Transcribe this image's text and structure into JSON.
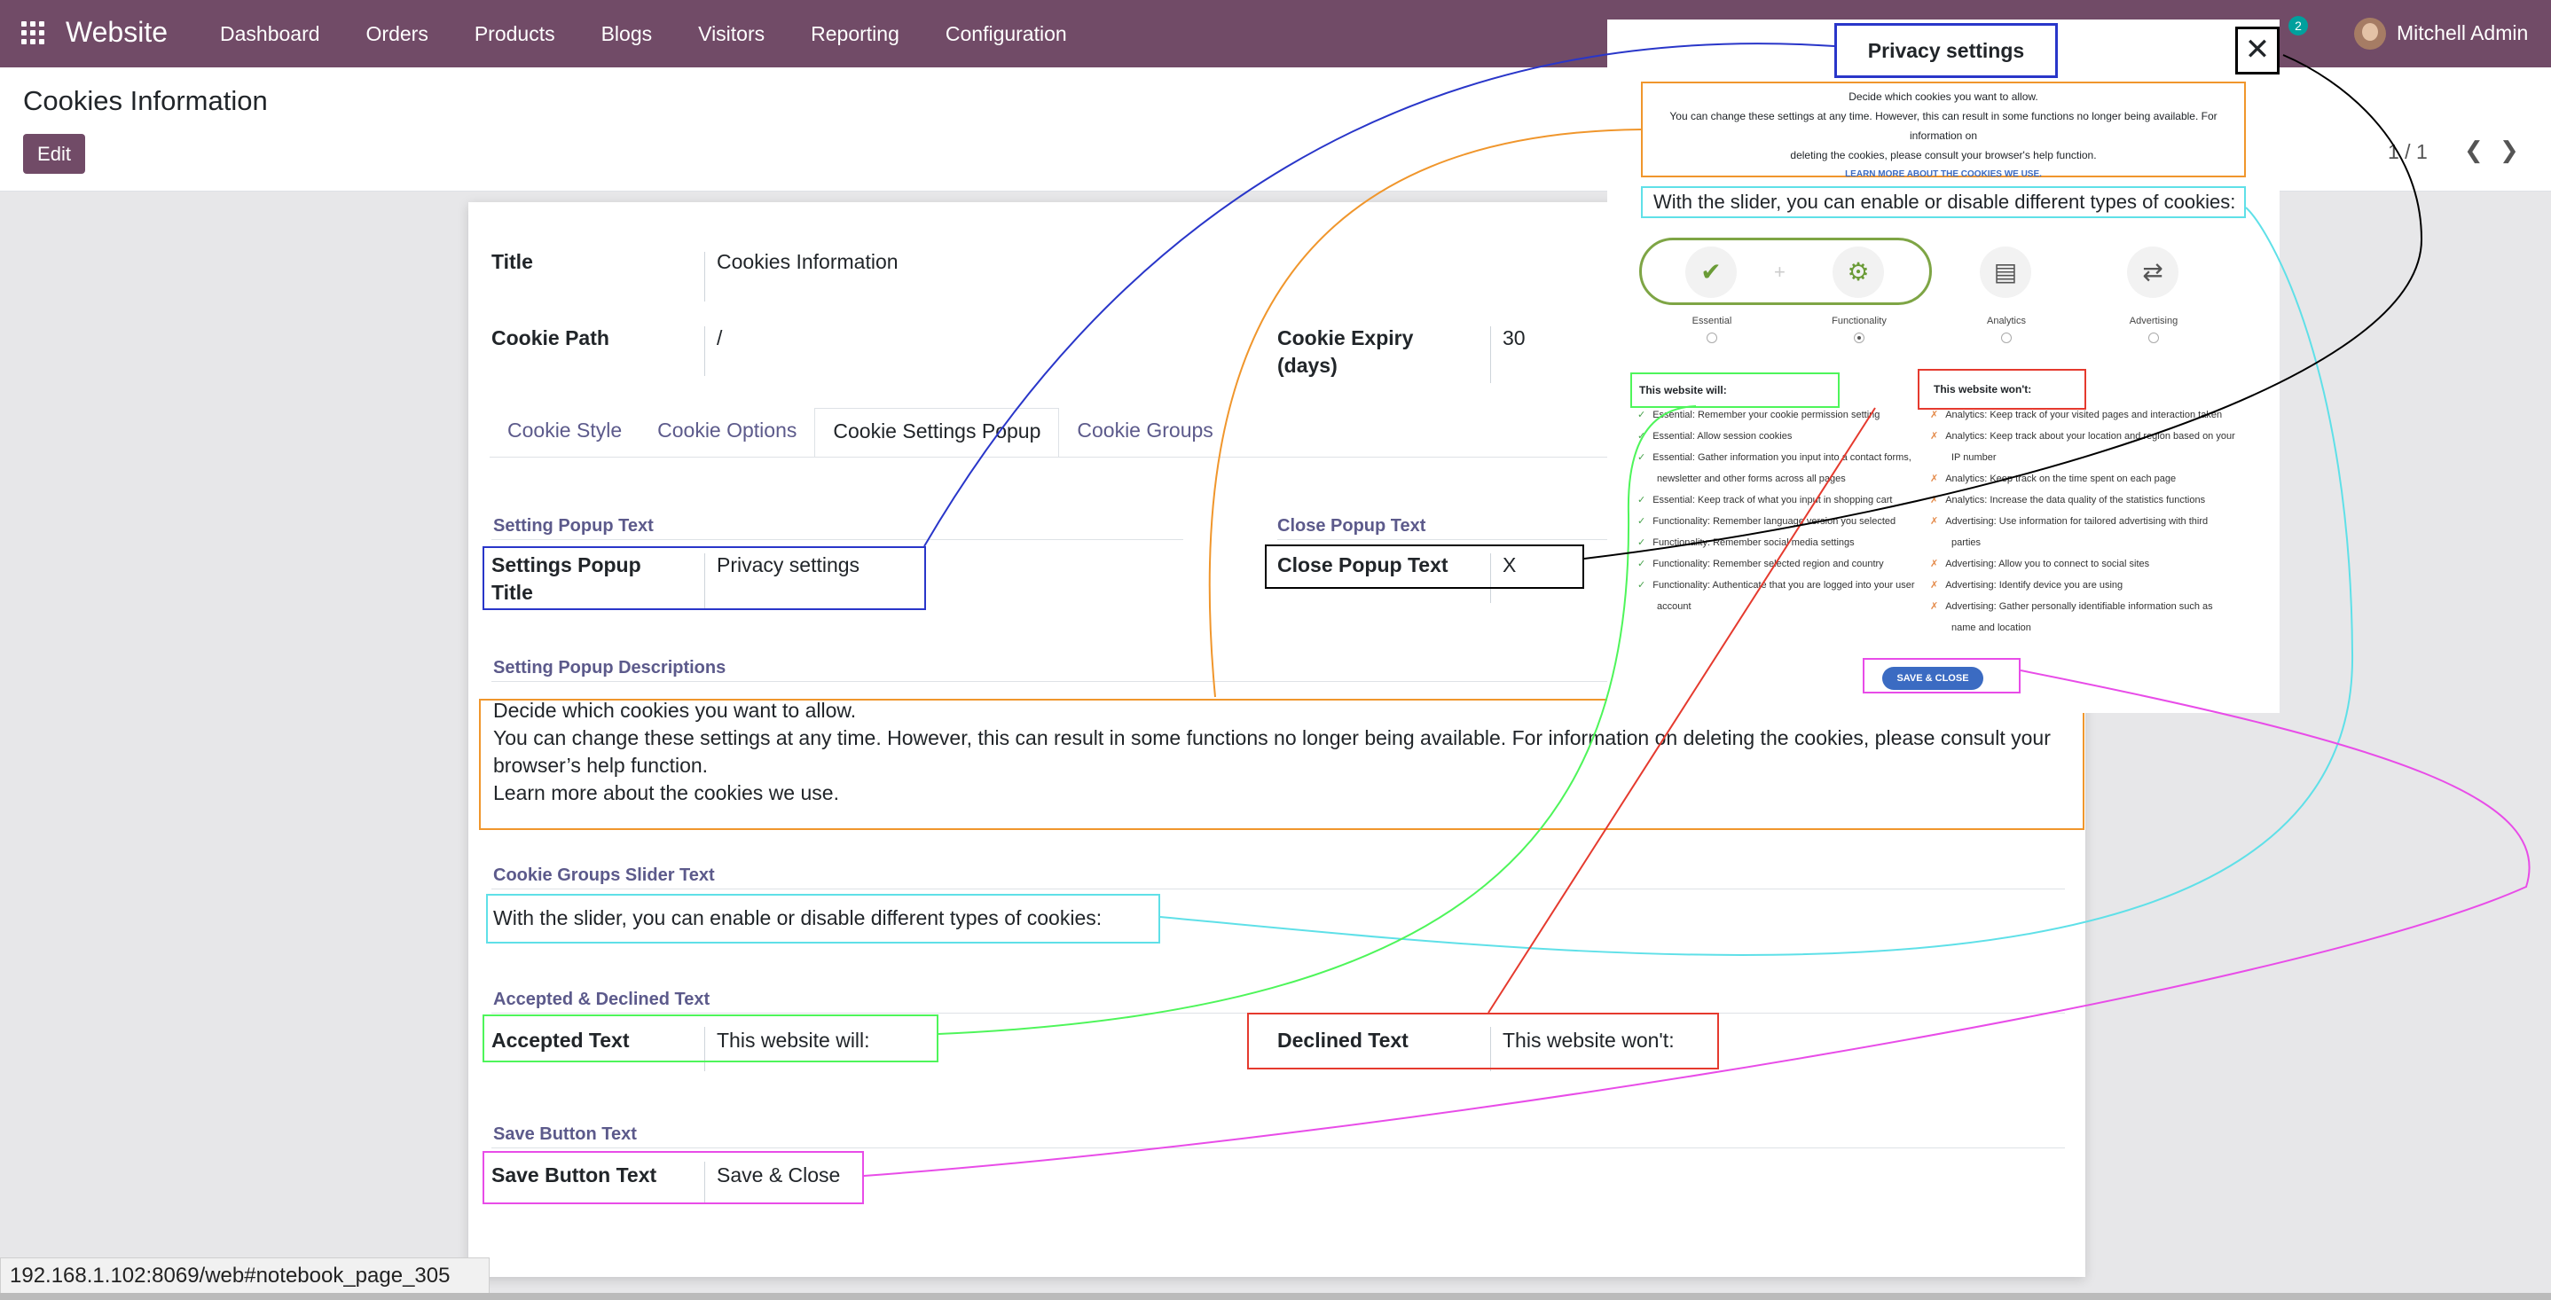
{
  "navbar": {
    "brand": "Website",
    "menu": [
      "Dashboard",
      "Orders",
      "Products",
      "Blogs",
      "Visitors",
      "Reporting",
      "Configuration"
    ],
    "chat_count": "2",
    "user": "Mitchell Admin"
  },
  "control_panel": {
    "title": "Cookies Information",
    "edit_label": "Edit",
    "pager": "1 / 1",
    "prev_icon": "chevron-left-icon",
    "next_icon": "chevron-right-icon"
  },
  "form": {
    "title_label": "Title",
    "title_value": "Cookies Information",
    "cookie_path_label": "Cookie Path",
    "cookie_path_value": "/",
    "cookie_expiry_label_1": "Cookie Expiry",
    "cookie_expiry_label_2": "(days)",
    "cookie_expiry_value": "30",
    "tabs": [
      "Cookie Style",
      "Cookie Options",
      "Cookie Settings Popup",
      "Cookie Groups"
    ],
    "active_tab": "Cookie Settings Popup",
    "setting_popup_text_section": "Setting Popup Text",
    "settings_popup_title_label_1": "Settings Popup",
    "settings_popup_title_label_2": "Title",
    "settings_popup_title_value": "Privacy settings",
    "close_popup_text_section": "Close Popup Text",
    "close_popup_text_label": "Close Popup Text",
    "close_popup_text_value": "X",
    "setting_popup_descriptions_section": "Setting Popup Descriptions",
    "description_lines": [
      "Decide which cookies you want to allow.",
      "You can change these settings at any time. However, this can result in some functions no longer being available. For information on deleting the cookies, please consult your",
      "browser’s help function.",
      "Learn more about the cookies we use."
    ],
    "cookie_groups_slider_text_section": "Cookie Groups Slider Text",
    "slider_text_value": "With the slider, you can enable or disable different types of cookies:",
    "accepted_declined_section": "Accepted & Declined Text",
    "accepted_text_label": "Accepted Text",
    "accepted_text_value": "This website will:",
    "declined_text_label": "Declined Text",
    "declined_text_value": "This website won't:",
    "save_button_text_section": "Save Button Text",
    "save_button_text_label": "Save Button Text",
    "save_button_text_value": "Save & Close"
  },
  "popup": {
    "title": "Privacy settings",
    "close": "✕",
    "desc_1": "Decide which cookies you want to allow.",
    "desc_2": "You can change these settings at any time. However, this can result in some functions no longer being available. For information on",
    "desc_3": "deleting the cookies, please consult your browser's help function.",
    "learn_more": "LEARN MORE ABOUT THE COOKIES WE USE.",
    "slider_text": "With the slider, you can enable or disable different types of cookies:",
    "categories": [
      "Essential",
      "Functionality",
      "Analytics",
      "Advertising"
    ],
    "category_icons": [
      "check-icon",
      "gear-icon",
      "bar-chart-icon",
      "exchange-icon"
    ],
    "will_heading": "This website will:",
    "wont_heading": "This website won't:",
    "will_items": [
      "Essential: Remember your cookie permission setting",
      "Essential: Allow session cookies",
      "Essential: Gather information you input into a contact forms,",
      "newsletter and other forms across all pages",
      "Essential: Keep track of what you input in shopping cart",
      "Functionality: Remember language version you selected",
      "Functionality: Remember social media settings",
      "Functionality: Remember selected region and country",
      "Functionality: Authenticate that you are logged into your user",
      "account"
    ],
    "wont_items": [
      "Analytics: Keep track of your visited pages and interaction taken",
      "Analytics: Keep track about your location and region based on your",
      "IP number",
      "Analytics: Keep track on the time spent on each page",
      "Analytics: Increase the data quality of the statistics functions",
      "Advertising: Use information for tailored advertising with third",
      "parties",
      "Advertising: Allow you to connect to social sites",
      "Advertising: Identify device you are using",
      "Advertising: Gather personally identifiable information such as",
      "name and location"
    ],
    "save_label": "SAVE & CLOSE"
  },
  "status_url": "192.168.1.102:8069/web#notebook_page_305",
  "colors": {
    "brand": "#714b67",
    "blue": "#2936c9",
    "orange": "#f0962c",
    "cyan": "#5fe0e8",
    "green": "#4ef55a",
    "red": "#e53a2e",
    "magenta": "#e84ce8",
    "black": "#000000"
  }
}
